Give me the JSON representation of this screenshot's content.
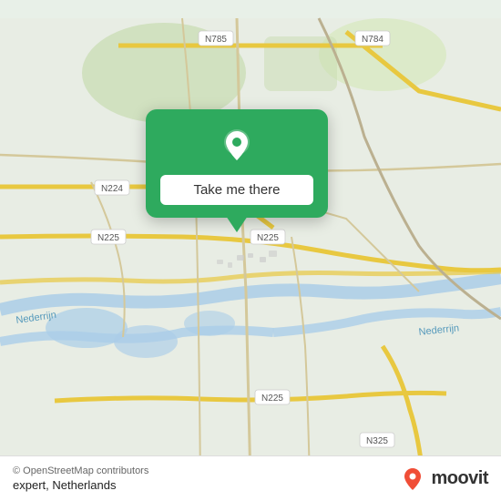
{
  "map": {
    "bg_color": "#e8efe8",
    "center_lat": 51.97,
    "center_lon": 5.92
  },
  "popup": {
    "button_label": "Take me there",
    "bg_color": "#2eaa5e"
  },
  "footer": {
    "copyright": "© OpenStreetMap contributors",
    "location": "expert, Netherlands",
    "moovit_label": "moovit"
  },
  "road_labels": [
    "N785",
    "N784",
    "N224",
    "N225",
    "N325"
  ],
  "water_label1": "Nederijn",
  "water_label2": "Nederijn"
}
